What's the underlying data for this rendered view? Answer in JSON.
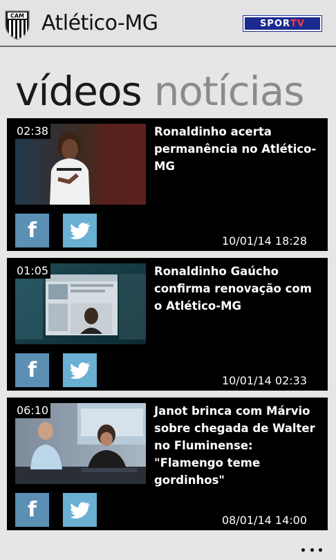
{
  "header": {
    "title": "Atlético-MG",
    "crest_text": "CAM",
    "broadcaster_logo": {
      "sport": "SPOR",
      "tv": "TV"
    }
  },
  "pivot": {
    "active": "vídeos",
    "inactive": "notícias"
  },
  "videos": [
    {
      "duration": "02:38",
      "title": "Ronaldinho acerta permanência no Atlético-MG",
      "timestamp": "10/01/14 18:28",
      "thumbnail_icon": "player-on-field-photo"
    },
    {
      "duration": "01:05",
      "title": "Ronaldinho Gaúcho confirma renovação com o Atlético-MG",
      "timestamp": "10/01/14 02:33",
      "thumbnail_icon": "social-media-screenshot-photo"
    },
    {
      "duration": "06:10",
      "title": "Janot brinca com Márvio sobre chegada de Walter no Fluminense: \"Flamengo teme gordinhos\"",
      "timestamp": "08/01/14 14:00",
      "thumbnail_icon": "tv-studio-photo"
    }
  ],
  "share_icons": [
    "facebook-icon",
    "twitter-icon"
  ],
  "colors": {
    "background": "#e6e6e6",
    "card": "#000000",
    "facebook": "#5b8fb3",
    "twitter": "#6ab0d2",
    "broadcaster": "#1b2a8f"
  },
  "app_bar": {
    "more_icon": "ellipsis-icon"
  }
}
